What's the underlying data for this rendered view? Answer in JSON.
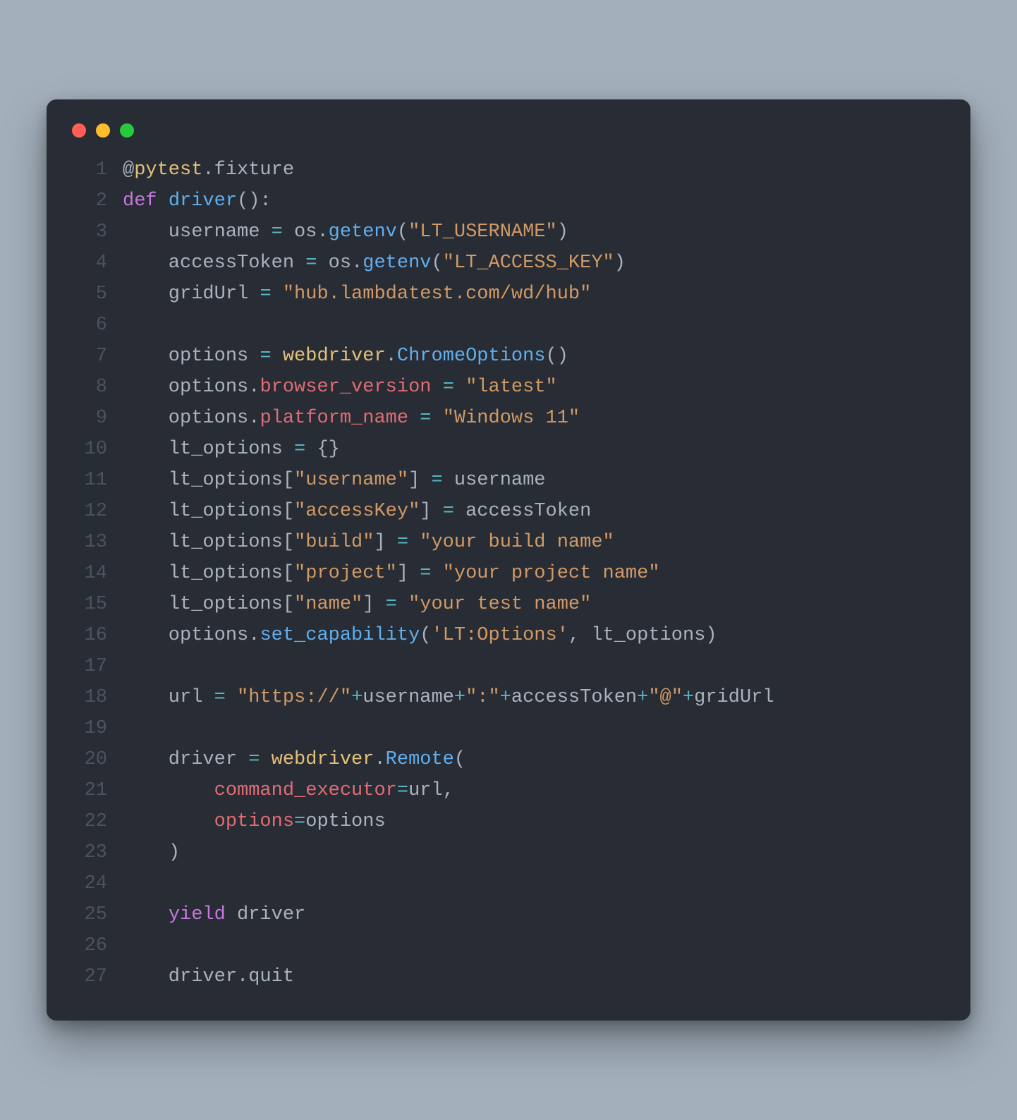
{
  "window": {
    "traffic_lights": [
      "red",
      "yellow",
      "green"
    ]
  },
  "code": {
    "lines": [
      {
        "n": "1",
        "tokens": [
          {
            "c": "tok-decor",
            "t": "@"
          },
          {
            "c": "tok-ns",
            "t": "pytest"
          },
          {
            "c": "tok-punc",
            "t": "."
          },
          {
            "c": "tok-ident",
            "t": "fixture"
          }
        ]
      },
      {
        "n": "2",
        "tokens": [
          {
            "c": "tok-kw",
            "t": "def "
          },
          {
            "c": "tok-fn",
            "t": "driver"
          },
          {
            "c": "tok-punc",
            "t": "():"
          }
        ]
      },
      {
        "n": "3",
        "tokens": [
          {
            "c": "tok-ident",
            "t": "    username "
          },
          {
            "c": "tok-op",
            "t": "="
          },
          {
            "c": "tok-ident",
            "t": " os"
          },
          {
            "c": "tok-punc",
            "t": "."
          },
          {
            "c": "tok-method",
            "t": "getenv"
          },
          {
            "c": "tok-punc",
            "t": "("
          },
          {
            "c": "tok-str2",
            "t": "\"LT_USERNAME\""
          },
          {
            "c": "tok-punc",
            "t": ")"
          }
        ]
      },
      {
        "n": "4",
        "tokens": [
          {
            "c": "tok-ident",
            "t": "    accessToken "
          },
          {
            "c": "tok-op",
            "t": "="
          },
          {
            "c": "tok-ident",
            "t": " os"
          },
          {
            "c": "tok-punc",
            "t": "."
          },
          {
            "c": "tok-method",
            "t": "getenv"
          },
          {
            "c": "tok-punc",
            "t": "("
          },
          {
            "c": "tok-str2",
            "t": "\"LT_ACCESS_KEY\""
          },
          {
            "c": "tok-punc",
            "t": ")"
          }
        ]
      },
      {
        "n": "5",
        "tokens": [
          {
            "c": "tok-ident",
            "t": "    gridUrl "
          },
          {
            "c": "tok-op",
            "t": "="
          },
          {
            "c": "tok-ident",
            "t": " "
          },
          {
            "c": "tok-str2",
            "t": "\"hub.lambdatest.com/wd/hub\""
          }
        ]
      },
      {
        "n": "6",
        "tokens": [
          {
            "c": "tok-ident",
            "t": ""
          }
        ]
      },
      {
        "n": "7",
        "tokens": [
          {
            "c": "tok-ident",
            "t": "    options "
          },
          {
            "c": "tok-op",
            "t": "="
          },
          {
            "c": "tok-ident",
            "t": " "
          },
          {
            "c": "tok-ns",
            "t": "webdriver"
          },
          {
            "c": "tok-punc",
            "t": "."
          },
          {
            "c": "tok-method",
            "t": "ChromeOptions"
          },
          {
            "c": "tok-punc",
            "t": "()"
          }
        ]
      },
      {
        "n": "8",
        "tokens": [
          {
            "c": "tok-ident",
            "t": "    options"
          },
          {
            "c": "tok-punc",
            "t": "."
          },
          {
            "c": "tok-param",
            "t": "browser_version"
          },
          {
            "c": "tok-ident",
            "t": " "
          },
          {
            "c": "tok-op",
            "t": "="
          },
          {
            "c": "tok-ident",
            "t": " "
          },
          {
            "c": "tok-str2",
            "t": "\"latest\""
          }
        ]
      },
      {
        "n": "9",
        "tokens": [
          {
            "c": "tok-ident",
            "t": "    options"
          },
          {
            "c": "tok-punc",
            "t": "."
          },
          {
            "c": "tok-param",
            "t": "platform_name"
          },
          {
            "c": "tok-ident",
            "t": " "
          },
          {
            "c": "tok-op",
            "t": "="
          },
          {
            "c": "tok-ident",
            "t": " "
          },
          {
            "c": "tok-str2",
            "t": "\"Windows 11\""
          }
        ]
      },
      {
        "n": "10",
        "tokens": [
          {
            "c": "tok-ident",
            "t": "    lt_options "
          },
          {
            "c": "tok-op",
            "t": "="
          },
          {
            "c": "tok-ident",
            "t": " "
          },
          {
            "c": "tok-punc",
            "t": "{}"
          }
        ]
      },
      {
        "n": "11",
        "tokens": [
          {
            "c": "tok-ident",
            "t": "    lt_options"
          },
          {
            "c": "tok-punc",
            "t": "["
          },
          {
            "c": "tok-str2",
            "t": "\"username\""
          },
          {
            "c": "tok-punc",
            "t": "]"
          },
          {
            "c": "tok-ident",
            "t": " "
          },
          {
            "c": "tok-op",
            "t": "="
          },
          {
            "c": "tok-ident",
            "t": " username"
          }
        ]
      },
      {
        "n": "12",
        "tokens": [
          {
            "c": "tok-ident",
            "t": "    lt_options"
          },
          {
            "c": "tok-punc",
            "t": "["
          },
          {
            "c": "tok-str2",
            "t": "\"accessKey\""
          },
          {
            "c": "tok-punc",
            "t": "]"
          },
          {
            "c": "tok-ident",
            "t": " "
          },
          {
            "c": "tok-op",
            "t": "="
          },
          {
            "c": "tok-ident",
            "t": " accessToken"
          }
        ]
      },
      {
        "n": "13",
        "tokens": [
          {
            "c": "tok-ident",
            "t": "    lt_options"
          },
          {
            "c": "tok-punc",
            "t": "["
          },
          {
            "c": "tok-str2",
            "t": "\"build\""
          },
          {
            "c": "tok-punc",
            "t": "]"
          },
          {
            "c": "tok-ident",
            "t": " "
          },
          {
            "c": "tok-op",
            "t": "="
          },
          {
            "c": "tok-ident",
            "t": " "
          },
          {
            "c": "tok-str2",
            "t": "\"your build name\""
          }
        ]
      },
      {
        "n": "14",
        "tokens": [
          {
            "c": "tok-ident",
            "t": "    lt_options"
          },
          {
            "c": "tok-punc",
            "t": "["
          },
          {
            "c": "tok-str2",
            "t": "\"project\""
          },
          {
            "c": "tok-punc",
            "t": "]"
          },
          {
            "c": "tok-ident",
            "t": " "
          },
          {
            "c": "tok-op",
            "t": "="
          },
          {
            "c": "tok-ident",
            "t": " "
          },
          {
            "c": "tok-str2",
            "t": "\"your project name\""
          }
        ]
      },
      {
        "n": "15",
        "tokens": [
          {
            "c": "tok-ident",
            "t": "    lt_options"
          },
          {
            "c": "tok-punc",
            "t": "["
          },
          {
            "c": "tok-str2",
            "t": "\"name\""
          },
          {
            "c": "tok-punc",
            "t": "]"
          },
          {
            "c": "tok-ident",
            "t": " "
          },
          {
            "c": "tok-op",
            "t": "="
          },
          {
            "c": "tok-ident",
            "t": " "
          },
          {
            "c": "tok-str2",
            "t": "\"your test name\""
          }
        ]
      },
      {
        "n": "16",
        "tokens": [
          {
            "c": "tok-ident",
            "t": "    options"
          },
          {
            "c": "tok-punc",
            "t": "."
          },
          {
            "c": "tok-method",
            "t": "set_capability"
          },
          {
            "c": "tok-punc",
            "t": "("
          },
          {
            "c": "tok-str2",
            "t": "'LT:Options'"
          },
          {
            "c": "tok-punc",
            "t": ", "
          },
          {
            "c": "tok-ident",
            "t": "lt_options"
          },
          {
            "c": "tok-punc",
            "t": ")"
          }
        ]
      },
      {
        "n": "17",
        "tokens": [
          {
            "c": "tok-ident",
            "t": ""
          }
        ]
      },
      {
        "n": "18",
        "tokens": [
          {
            "c": "tok-ident",
            "t": "    url "
          },
          {
            "c": "tok-op",
            "t": "="
          },
          {
            "c": "tok-ident",
            "t": " "
          },
          {
            "c": "tok-str2",
            "t": "\"https://\""
          },
          {
            "c": "tok-op",
            "t": "+"
          },
          {
            "c": "tok-ident",
            "t": "username"
          },
          {
            "c": "tok-op",
            "t": "+"
          },
          {
            "c": "tok-str2",
            "t": "\":\""
          },
          {
            "c": "tok-op",
            "t": "+"
          },
          {
            "c": "tok-ident",
            "t": "accessToken"
          },
          {
            "c": "tok-op",
            "t": "+"
          },
          {
            "c": "tok-str2",
            "t": "\"@\""
          },
          {
            "c": "tok-op",
            "t": "+"
          },
          {
            "c": "tok-ident",
            "t": "gridUrl"
          }
        ]
      },
      {
        "n": "19",
        "tokens": [
          {
            "c": "tok-ident",
            "t": ""
          }
        ]
      },
      {
        "n": "20",
        "tokens": [
          {
            "c": "tok-ident",
            "t": "    driver "
          },
          {
            "c": "tok-op",
            "t": "="
          },
          {
            "c": "tok-ident",
            "t": " "
          },
          {
            "c": "tok-ns",
            "t": "webdriver"
          },
          {
            "c": "tok-punc",
            "t": "."
          },
          {
            "c": "tok-method",
            "t": "Remote"
          },
          {
            "c": "tok-punc",
            "t": "("
          }
        ]
      },
      {
        "n": "21",
        "tokens": [
          {
            "c": "tok-ident",
            "t": "        "
          },
          {
            "c": "tok-param",
            "t": "command_executor"
          },
          {
            "c": "tok-op",
            "t": "="
          },
          {
            "c": "tok-ident",
            "t": "url"
          },
          {
            "c": "tok-punc",
            "t": ","
          }
        ]
      },
      {
        "n": "22",
        "tokens": [
          {
            "c": "tok-ident",
            "t": "        "
          },
          {
            "c": "tok-param",
            "t": "options"
          },
          {
            "c": "tok-op",
            "t": "="
          },
          {
            "c": "tok-ident",
            "t": "options"
          }
        ]
      },
      {
        "n": "23",
        "tokens": [
          {
            "c": "tok-ident",
            "t": "    "
          },
          {
            "c": "tok-punc",
            "t": ")"
          }
        ]
      },
      {
        "n": "24",
        "tokens": [
          {
            "c": "tok-ident",
            "t": ""
          }
        ]
      },
      {
        "n": "25",
        "tokens": [
          {
            "c": "tok-ident",
            "t": "    "
          },
          {
            "c": "tok-kw",
            "t": "yield"
          },
          {
            "c": "tok-ident",
            "t": " driver"
          }
        ]
      },
      {
        "n": "26",
        "tokens": [
          {
            "c": "tok-ident",
            "t": ""
          }
        ]
      },
      {
        "n": "27",
        "tokens": [
          {
            "c": "tok-ident",
            "t": "    driver"
          },
          {
            "c": "tok-punc",
            "t": "."
          },
          {
            "c": "tok-ident",
            "t": "quit"
          }
        ]
      }
    ]
  }
}
